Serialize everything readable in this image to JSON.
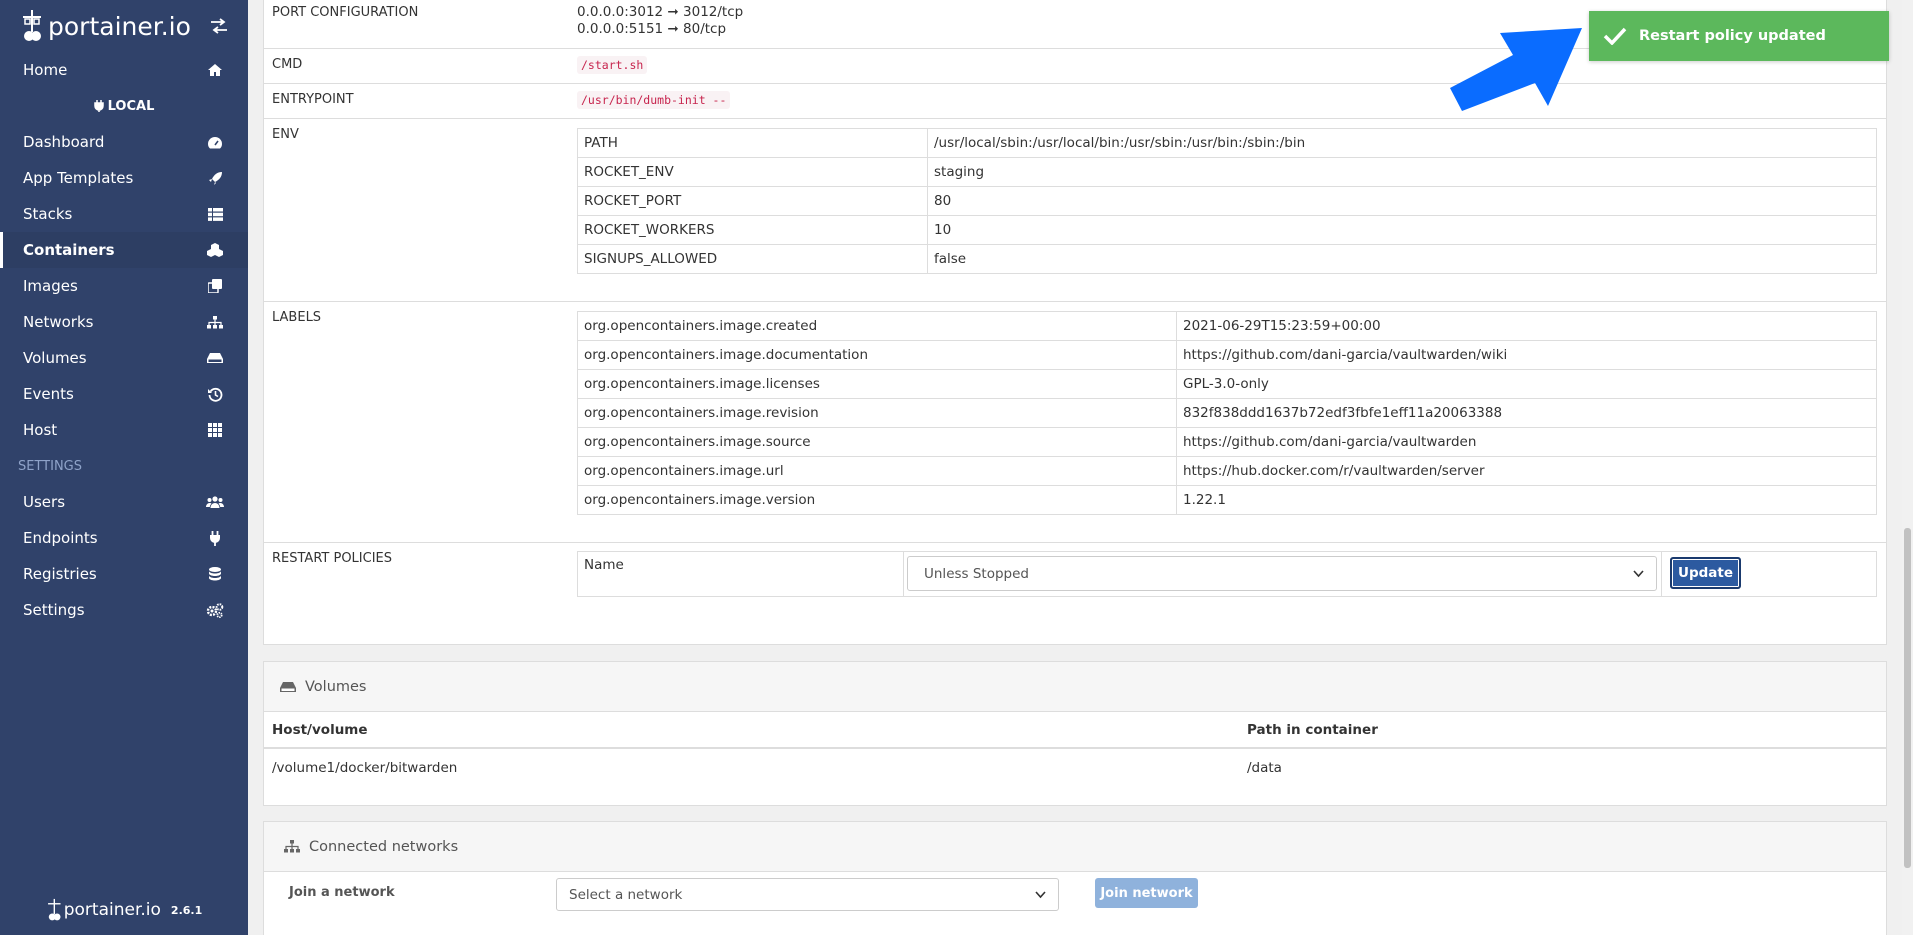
{
  "sidebar": {
    "logo_text": "portainer.io",
    "items_top": [
      {
        "label": "Home",
        "icon": "home-icon"
      }
    ],
    "endpoint_label": "LOCAL",
    "items_endpoint": [
      {
        "label": "Dashboard",
        "icon": "tachometer-icon"
      },
      {
        "label": "App Templates",
        "icon": "rocket-icon"
      },
      {
        "label": "Stacks",
        "icon": "th-list-icon"
      },
      {
        "label": "Containers",
        "icon": "cubes-icon"
      },
      {
        "label": "Images",
        "icon": "clone-icon"
      },
      {
        "label": "Networks",
        "icon": "sitemap-icon"
      },
      {
        "label": "Volumes",
        "icon": "hdd-icon"
      },
      {
        "label": "Events",
        "icon": "history-icon"
      },
      {
        "label": "Host",
        "icon": "th-icon"
      }
    ],
    "settings_title": "SETTINGS",
    "items_settings": [
      {
        "label": "Users",
        "icon": "users-icon"
      },
      {
        "label": "Endpoints",
        "icon": "plug-icon"
      },
      {
        "label": "Registries",
        "icon": "database-icon"
      },
      {
        "label": "Settings",
        "icon": "cogs-icon"
      }
    ],
    "footer_logo": "portainer.io",
    "version": "2.6.1"
  },
  "details": {
    "port_config_key": "PORT CONFIGURATION",
    "port_lines": [
      "0.0.0.0:3012 ➞ 3012/tcp",
      "0.0.0.0:5151 ➞ 80/tcp"
    ],
    "cmd_key": "CMD",
    "cmd_value": "/start.sh",
    "entrypoint_key": "ENTRYPOINT",
    "entrypoint_value": "/usr/bin/dumb-init --",
    "env_key": "ENV",
    "env": [
      [
        "PATH",
        "/usr/local/sbin:/usr/local/bin:/usr/sbin:/usr/bin:/sbin:/bin"
      ],
      [
        "ROCKET_ENV",
        "staging"
      ],
      [
        "ROCKET_PORT",
        "80"
      ],
      [
        "ROCKET_WORKERS",
        "10"
      ],
      [
        "SIGNUPS_ALLOWED",
        "false"
      ]
    ],
    "labels_key": "LABELS",
    "labels": [
      [
        "org.opencontainers.image.created",
        "2021-06-29T15:23:59+00:00"
      ],
      [
        "org.opencontainers.image.documentation",
        "https://github.com/dani-garcia/vaultwarden/wiki"
      ],
      [
        "org.opencontainers.image.licenses",
        "GPL-3.0-only"
      ],
      [
        "org.opencontainers.image.revision",
        "832f838ddd1637b72edf3fbfe1eff11a20063388"
      ],
      [
        "org.opencontainers.image.source",
        "https://github.com/dani-garcia/vaultwarden"
      ],
      [
        "org.opencontainers.image.url",
        "https://hub.docker.com/r/vaultwarden/server"
      ],
      [
        "org.opencontainers.image.version",
        "1.22.1"
      ]
    ],
    "restart_key": "RESTART POLICIES",
    "restart_name_label": "Name",
    "restart_selected": "Unless Stopped",
    "update_label": "Update"
  },
  "volumes": {
    "title": "Volumes",
    "col_host": "Host/volume",
    "col_path": "Path in container",
    "rows": [
      [
        "/volume1/docker/bitwarden",
        "/data"
      ]
    ]
  },
  "networks": {
    "title": "Connected networks",
    "join_label": "Join a network",
    "select_placeholder": "Select a network",
    "join_button": "Join network"
  },
  "toast": {
    "message": "Restart policy updated",
    "color": "#5cb85c"
  },
  "colors": {
    "sidebar_bg": "#30426a",
    "accent": "#2c5aa0"
  }
}
